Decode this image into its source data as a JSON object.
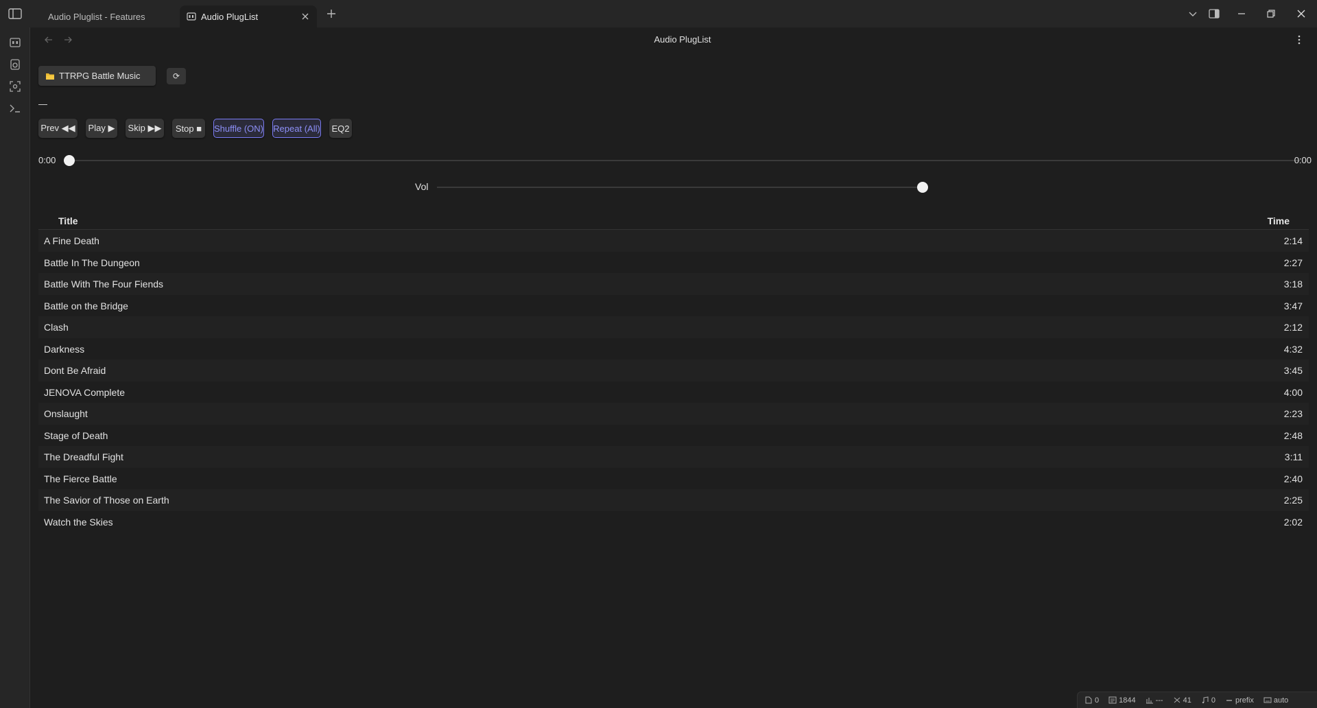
{
  "tabs": [
    {
      "label": "Audio Pluglist - Features",
      "active": false
    },
    {
      "label": "Audio PlugList",
      "active": true
    }
  ],
  "header": {
    "title": "Audio PlugList"
  },
  "folder": {
    "label": "TTRPG Battle Music",
    "refresh": "⟳"
  },
  "now_playing": "—",
  "controls": {
    "prev": "Prev ◀◀",
    "play": "Play ▶",
    "skip": "Skip ▶▶",
    "stop": "Stop ■",
    "shuffle": "Shuffle (ON)",
    "repeat": "Repeat (All)",
    "eq": "EQ2"
  },
  "seek": {
    "current": "0:00",
    "total": "0:00",
    "progress": 0
  },
  "volume": {
    "label": "Vol",
    "level": 1.0
  },
  "table": {
    "columns": {
      "title": "Title",
      "time": "Time"
    },
    "rows": [
      {
        "title": "A Fine Death",
        "time": "2:14"
      },
      {
        "title": "Battle In The Dungeon",
        "time": "2:27"
      },
      {
        "title": "Battle With The Four Fiends",
        "time": "3:18"
      },
      {
        "title": "Battle on the Bridge",
        "time": "3:47"
      },
      {
        "title": "Clash",
        "time": "2:12"
      },
      {
        "title": "Darkness",
        "time": "4:32"
      },
      {
        "title": "Dont Be Afraid",
        "time": "3:45"
      },
      {
        "title": "JENOVA Complete",
        "time": "4:00"
      },
      {
        "title": "Onslaught",
        "time": "2:23"
      },
      {
        "title": "Stage of Death",
        "time": "2:48"
      },
      {
        "title": "The Dreadful Fight",
        "time": "3:11"
      },
      {
        "title": "The Fierce Battle",
        "time": "2:40"
      },
      {
        "title": "The Savior of Those on Earth",
        "time": "2:25"
      },
      {
        "title": "Watch the Skies",
        "time": "2:02"
      }
    ]
  },
  "statusbar": {
    "backlinks": "0",
    "words": "1844",
    "chart": "---",
    "links": "41",
    "notes": "0",
    "prefix": "prefix",
    "mode": "auto"
  },
  "colors": {
    "accent": "#7b7cf5",
    "background": "#1e1e1e",
    "panel": "#262626"
  }
}
